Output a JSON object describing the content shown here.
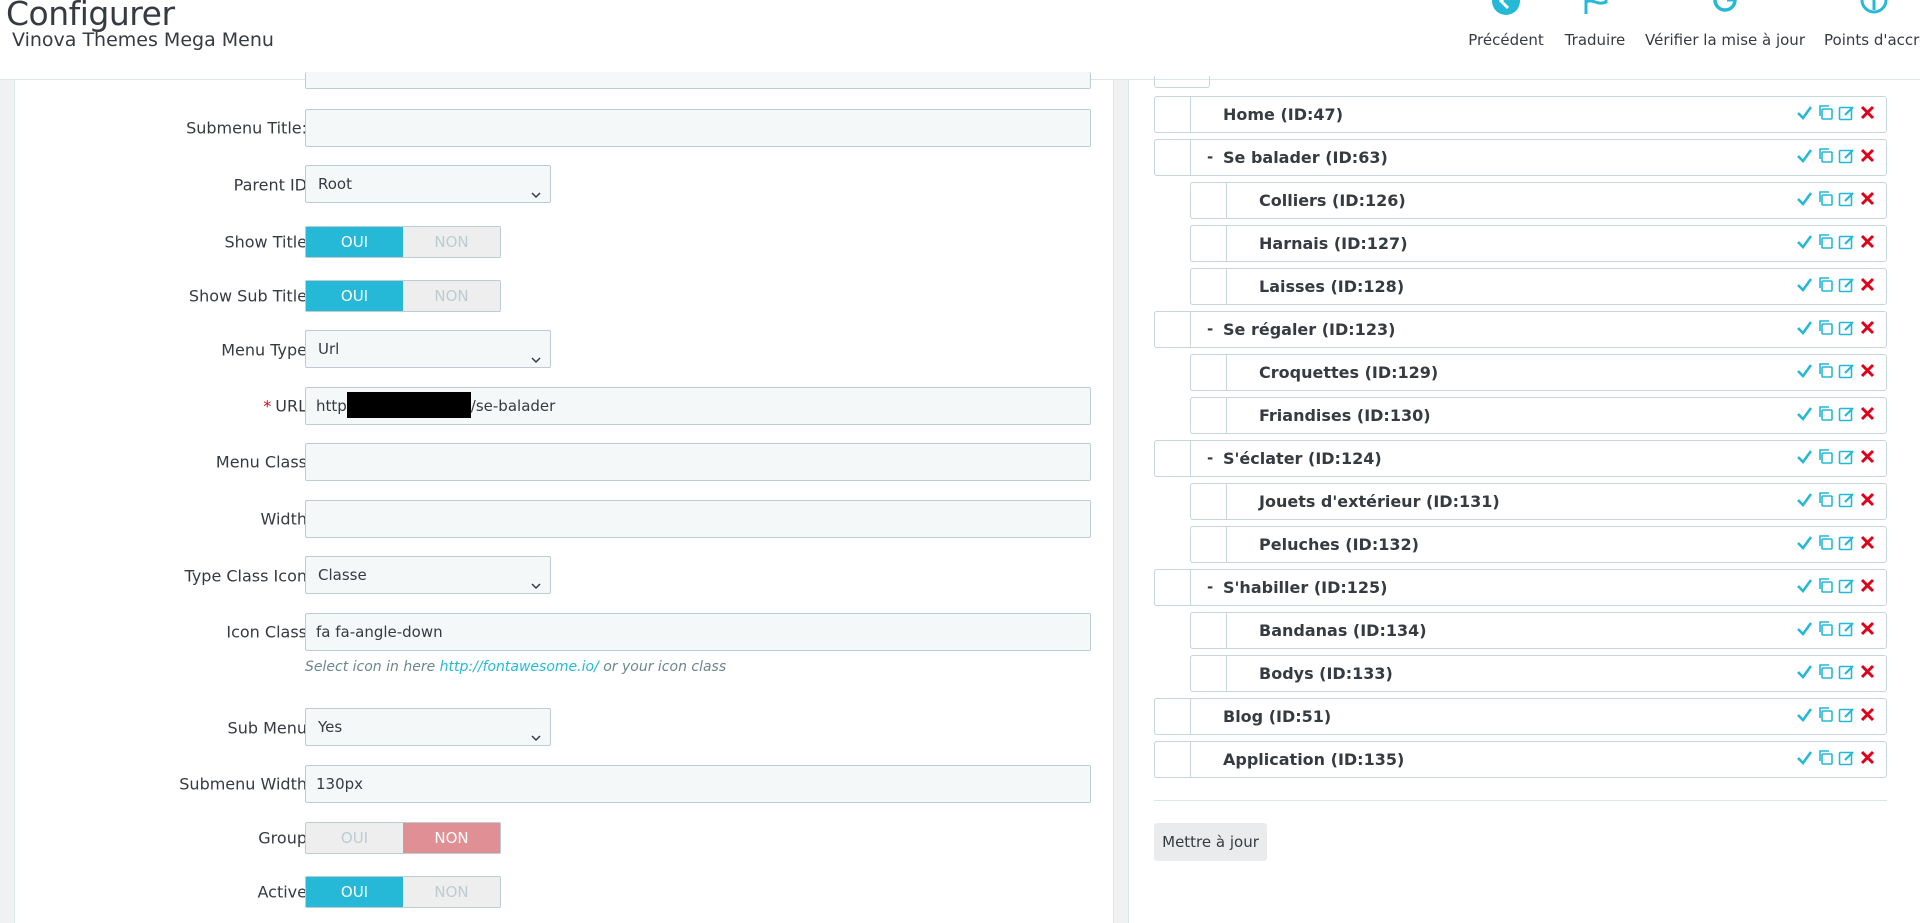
{
  "header": {
    "title": "Configurer",
    "subtitle": "Vinova Themes Mega Menu",
    "toolbar": [
      {
        "label": "Précédent",
        "icon": "back-arrow-icon"
      },
      {
        "label": "Traduire",
        "icon": "flag-icon"
      },
      {
        "label": "Vérifier la mise à jour",
        "icon": "refresh-icon"
      },
      {
        "label": "Points d'accroche",
        "icon": "anchor-icon"
      }
    ]
  },
  "form": {
    "submenu_title_label": "Submenu Title:",
    "submenu_title_value": "",
    "parent_id_label": "Parent ID",
    "parent_id_value": "Root",
    "show_title_label": "Show Title",
    "show_sub_title_label": "Show Sub Title",
    "menu_type_label": "Menu Type",
    "menu_type_value": "Url",
    "url_label": "URL",
    "url_required_mark": "*",
    "url_value_prefix": "http",
    "url_value_suffix": "/se-balader",
    "menu_class_label": "Menu Class",
    "menu_class_value": "",
    "width_label": "Width",
    "width_value": "",
    "type_class_icon_label": "Type Class Icon",
    "type_class_icon_value": "Classe",
    "icon_class_label": "Icon Class",
    "icon_class_value": "fa fa-angle-down",
    "icon_help_prefix": "Select icon in here ",
    "icon_help_link": "http://fontawesome.io/",
    "icon_help_suffix": " or your icon class",
    "sub_menu_label": "Sub Menu",
    "sub_menu_value": "Yes",
    "submenu_width_label": "Submenu Width",
    "submenu_width_value": "130px",
    "group_label": "Group",
    "active_label": "Active",
    "toggle_yes": "OUI",
    "toggle_no": "NON",
    "toggles": {
      "show_title": "OUI",
      "show_sub_title": "OUI",
      "group": "NON",
      "active": "OUI"
    }
  },
  "tree": {
    "items": [
      {
        "label": "Home (ID:47)",
        "level": 0,
        "collapsible": false
      },
      {
        "label": "Se balader (ID:63)",
        "level": 0,
        "collapsible": true
      },
      {
        "label": "Colliers (ID:126)",
        "level": 1,
        "collapsible": false
      },
      {
        "label": "Harnais (ID:127)",
        "level": 1,
        "collapsible": false
      },
      {
        "label": "Laisses (ID:128)",
        "level": 1,
        "collapsible": false
      },
      {
        "label": "Se régaler (ID:123)",
        "level": 0,
        "collapsible": true
      },
      {
        "label": "Croquettes (ID:129)",
        "level": 1,
        "collapsible": false
      },
      {
        "label": "Friandises (ID:130)",
        "level": 1,
        "collapsible": false
      },
      {
        "label": "S'éclater (ID:124)",
        "level": 0,
        "collapsible": true
      },
      {
        "label": "Jouets d'extérieur (ID:131)",
        "level": 1,
        "collapsible": false
      },
      {
        "label": "Peluches (ID:132)",
        "level": 1,
        "collapsible": false
      },
      {
        "label": "S'habiller (ID:125)",
        "level": 0,
        "collapsible": true
      },
      {
        "label": "Bandanas (ID:134)",
        "level": 1,
        "collapsible": false
      },
      {
        "label": "Bodys (ID:133)",
        "level": 1,
        "collapsible": false
      },
      {
        "label": "Blog (ID:51)",
        "level": 0,
        "collapsible": false
      },
      {
        "label": "Application (ID:135)",
        "level": 0,
        "collapsible": false
      }
    ],
    "collapse_symbol": "-",
    "update_button": "Mettre à jour"
  },
  "colors": {
    "primary": "#25b9d7",
    "danger": "#e0001a",
    "toggle_no_active": "#e08f95"
  }
}
